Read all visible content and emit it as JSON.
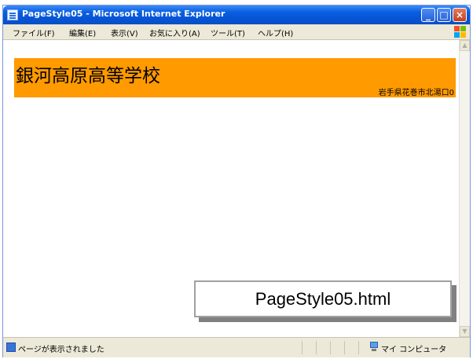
{
  "window": {
    "title": "PageStyle05 - Microsoft Internet Explorer",
    "buttons": {
      "minimize": "_",
      "maximize": "□",
      "close": "×"
    }
  },
  "menu": {
    "items": [
      "ファイル(F)",
      "編集(E)",
      "表示(V)",
      "お気に入り(A)",
      "ツール(T)",
      "ヘルプ(H)"
    ]
  },
  "page": {
    "school_name": "銀河高原高等学校",
    "address": "岩手県花巻市北湯口0",
    "header_color": "#ff9a00"
  },
  "status": {
    "message": "ページが表示されました",
    "zone": "マイ コンピュータ"
  },
  "caption": {
    "filename": "PageStyle05.html"
  },
  "icons": {
    "title": "ie-page-icon",
    "menu_logo": "windows-logo-icon",
    "status": "page-done-icon",
    "zone": "my-computer-icon"
  }
}
